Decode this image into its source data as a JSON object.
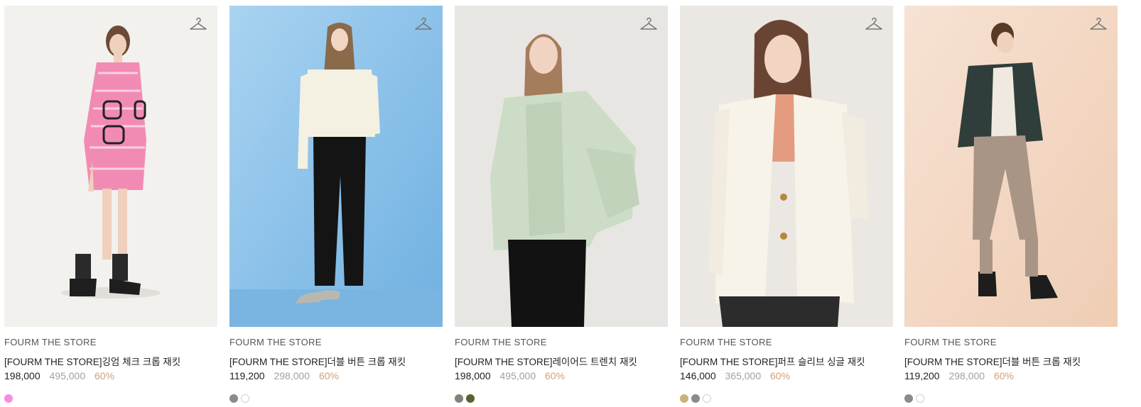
{
  "products": [
    {
      "brand": "FOURM THE STORE",
      "name": "[FOURM THE STORE]깅엄 체크 크롭 재킷",
      "sale_price": "198,000",
      "original_price": "495,000",
      "discount": "60%",
      "bg_color": "#f3f1ed",
      "swatches": [
        "#f58de0"
      ]
    },
    {
      "brand": "FOURM THE STORE",
      "name": "[FOURM THE STORE]더블 버튼 크롭 재킷",
      "sale_price": "119,200",
      "original_price": "298,000",
      "discount": "60%",
      "bg_color": "#86bde6",
      "swatches": [
        "#8c8c84",
        "#ffffff"
      ]
    },
    {
      "brand": "FOURM THE STORE",
      "name": "[FOURM THE STORE]레이어드 트렌치 재킷",
      "sale_price": "198,000",
      "original_price": "495,000",
      "discount": "60%",
      "bg_color": "#e8e6e3",
      "swatches": [
        "#7f8479",
        "#5c5f2e"
      ]
    },
    {
      "brand": "FOURM THE STORE",
      "name": "[FOURM THE STORE]퍼프 슬리브 싱글 재킷",
      "sale_price": "146,000",
      "original_price": "365,000",
      "discount": "60%",
      "bg_color": "#ebe7e3",
      "swatches": [
        "#c8b378",
        "#8a8a86",
        "#ffffff"
      ]
    },
    {
      "brand": "FOURM THE STORE",
      "name": "[FOURM THE STORE]더블 버튼 크롭 재킷",
      "sale_price": "119,200",
      "original_price": "298,000",
      "discount": "60%",
      "bg_color": "#f5dcc8",
      "swatches": [
        "#8c8c84",
        "#ffffff"
      ]
    }
  ]
}
